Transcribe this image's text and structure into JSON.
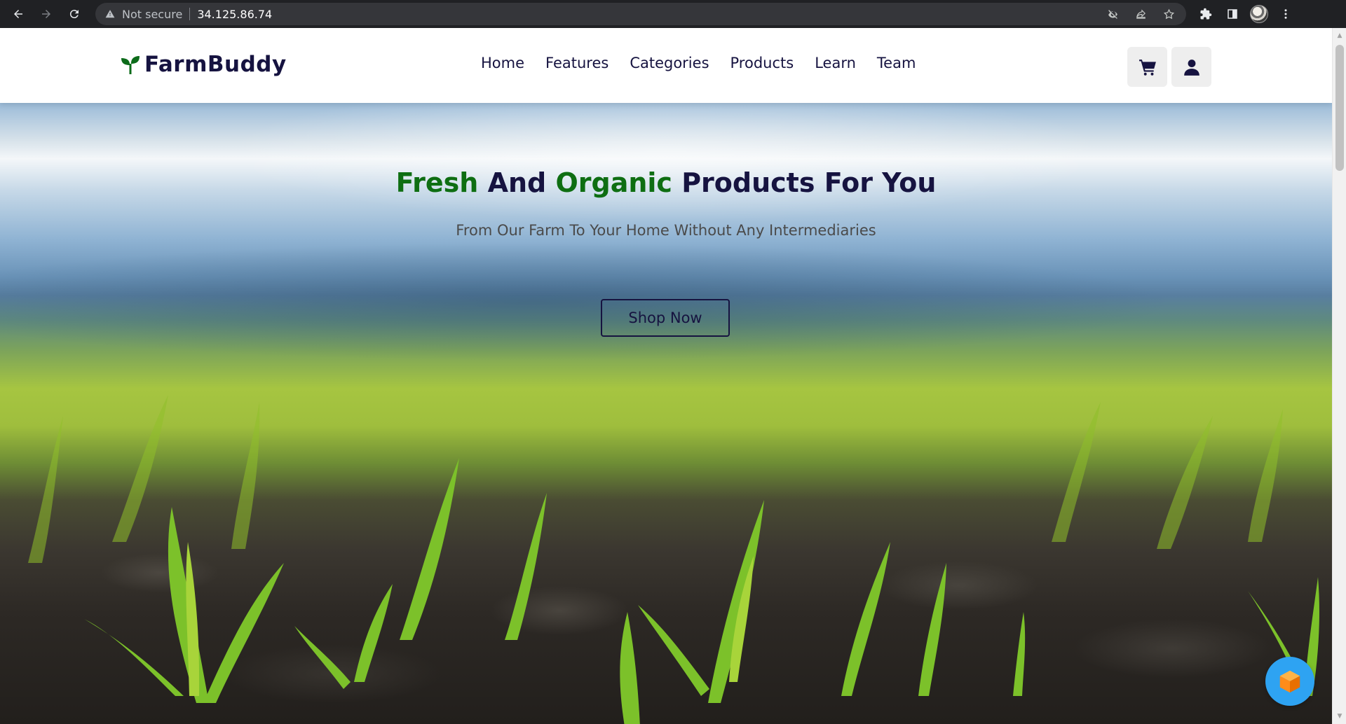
{
  "browser": {
    "security_label": "Not secure",
    "url": "34.125.86.74"
  },
  "site": {
    "logo_text": "FarmBuddy",
    "nav": [
      "Home",
      "Features",
      "Categories",
      "Products",
      "Learn",
      "Team"
    ]
  },
  "hero": {
    "title_part1": "Fresh",
    "title_part2": "And",
    "title_part3": "Organic",
    "title_part4": "Products For You",
    "subtitle": "From Our Farm To Your Home Without Any Intermediaries",
    "cta_label": "Shop Now"
  },
  "colors": {
    "brand_navy": "#161340",
    "brand_green": "#0e6e12",
    "chat_widget": "#2ea3f2"
  },
  "icons": {
    "cart": "cart-icon",
    "user": "user-icon",
    "logo": "sprout-icon",
    "chat": "cube-icon"
  }
}
